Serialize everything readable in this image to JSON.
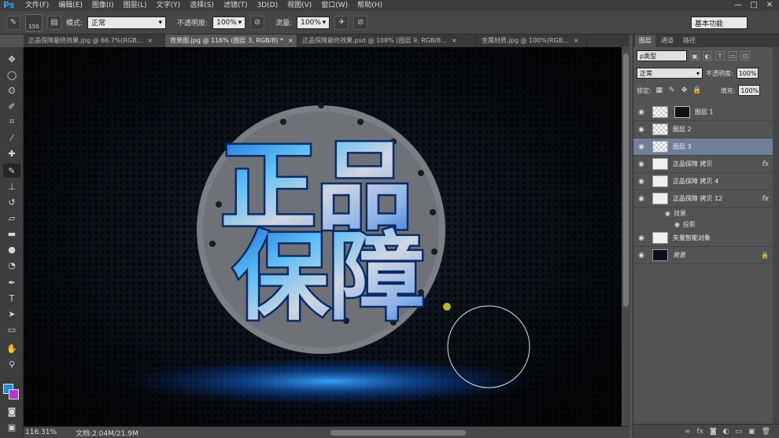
{
  "app": {
    "logo": "Ps"
  },
  "menu": [
    "文件(F)",
    "编辑(E)",
    "图像(I)",
    "图层(L)",
    "文字(Y)",
    "选择(S)",
    "滤镜(T)",
    "3D(D)",
    "视图(V)",
    "窗口(W)",
    "帮助(H)"
  ],
  "window_buttons": {
    "minimize": "—",
    "maximize": "□",
    "close": "✕"
  },
  "options": {
    "brush_size": "150",
    "mode_label": "模式:",
    "mode_value": "正常",
    "opacity_label": "不透明度:",
    "opacity_value": "100%",
    "flow_label": "流量:",
    "flow_value": "100%",
    "workspace": "基本功能"
  },
  "tabs": [
    {
      "label": "正品保障最终效果.jpg @ 66.7%(RGB...",
      "close": "×"
    },
    {
      "label": "背景图.jpg @ 116% (图层 3, RGB/8) *",
      "close": "×"
    },
    {
      "label": "正品保障最终效果.psd @ 108% (图层 9, RGB/8...",
      "close": "×"
    },
    {
      "label": "金属材质.jpg @ 100%(RGB...",
      "close": "×"
    }
  ],
  "canvas": {
    "line1": "正品",
    "line2": "保障"
  },
  "status": {
    "zoom": "116.31%",
    "doc": "文档:2.04M/21.9M"
  },
  "panel": {
    "tabs": [
      "图层",
      "通道",
      "路径"
    ],
    "kind_label": "ρ类型",
    "blend_mode": "正常",
    "opacity_label": "不透明度:",
    "opacity_value": "100%",
    "lock_label": "锁定:",
    "fill_label": "填充:",
    "fill_value": "100%"
  },
  "layers": [
    {
      "name": "图层 1",
      "thumb": "mask"
    },
    {
      "name": "图层 2",
      "thumb": "trans"
    },
    {
      "name": "图层 3",
      "thumb": "trans",
      "selected": true
    },
    {
      "name": "正品保障 拷贝",
      "thumb": "text",
      "fx": true
    },
    {
      "name": "正品保障 拷贝 4",
      "thumb": "text"
    },
    {
      "name": "正品保障 拷贝 12",
      "thumb": "text",
      "fx": true
    },
    {
      "name": "矢量智能对象",
      "thumb": "text"
    },
    {
      "name": "背景",
      "thumb": "dark",
      "locked": true
    }
  ],
  "effects": {
    "label": "效果",
    "shadow": "投影"
  },
  "colors": {
    "foreground": "#1b8ee0",
    "background": "#b03ad8",
    "selected_layer": "#6f7f99"
  }
}
